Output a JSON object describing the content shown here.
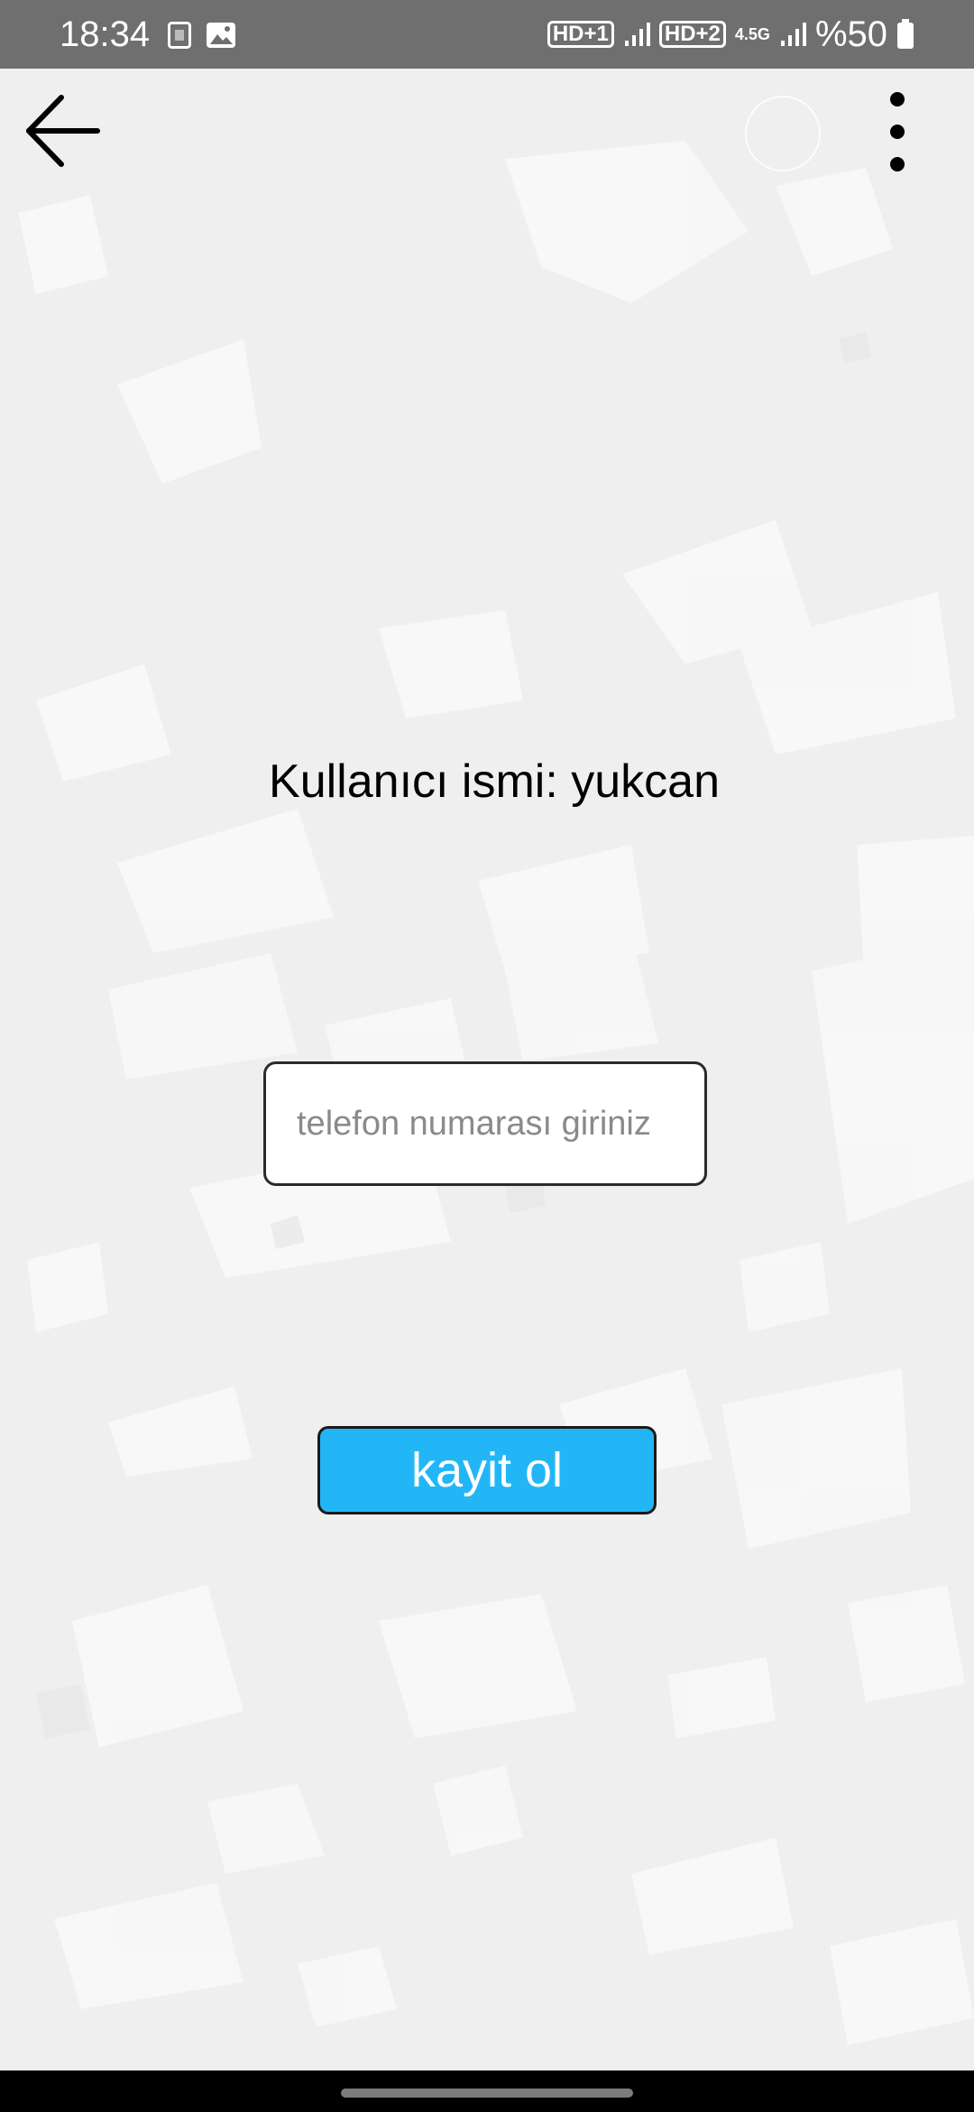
{
  "status_bar": {
    "time": "18:34",
    "notification_icons": [
      "app-k-icon",
      "image-icon"
    ],
    "sim1_label": "HD+1",
    "sim2_label": "HD+2",
    "network_type": "4.5G",
    "battery_text": "%50"
  },
  "toolbar": {
    "back_icon": "arrow-left-icon",
    "menu_icon": "more-vertical-icon"
  },
  "main": {
    "username_label": "Kullanıcı ismi: yukcan",
    "phone_input": {
      "value": "",
      "placeholder": "telefon numarası giriniz"
    },
    "register_button_label": "kayit ol"
  },
  "colors": {
    "accent": "#23b6f7",
    "status_bar": "#6f6f6f",
    "background": "#efefef"
  }
}
